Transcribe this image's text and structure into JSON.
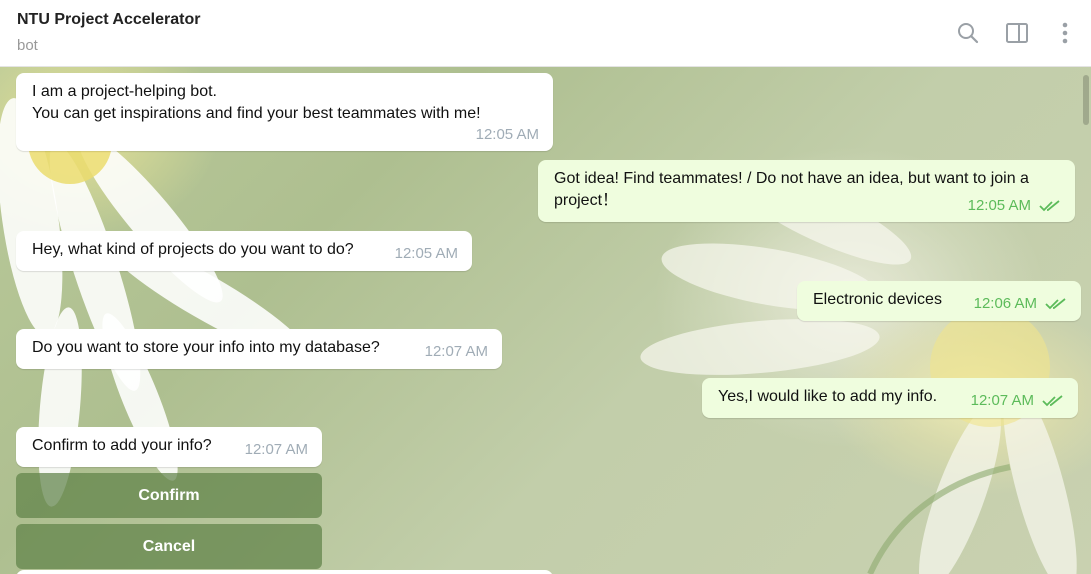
{
  "header": {
    "title": "NTU Project Accelerator",
    "subtitle": "bot"
  },
  "icons": {
    "search": "search-icon",
    "panel": "sidebar-panel-icon",
    "more": "more-vertical-icon",
    "read": "double-check-icon"
  },
  "colors": {
    "incoming_bubble": "#ffffff",
    "outgoing_bubble": "#effdde",
    "outgoing_time": "#5cbb5a",
    "keyboard_button": "#6a8a55"
  },
  "messages": [
    {
      "dir": "in",
      "lines": [
        "I am a project-helping bot.",
        "You can get inspirations and find your best teammates with me!"
      ],
      "time": "12:05 AM"
    },
    {
      "dir": "out",
      "lines": [
        "Got idea! Find teammates! / Do not have an idea, but want to join a",
        "project！"
      ],
      "time": "12:05 AM"
    },
    {
      "dir": "in",
      "lines": [
        "Hey, what kind of projects do you want to do?"
      ],
      "time": "12:05 AM"
    },
    {
      "dir": "out",
      "lines": [
        "Electronic devices"
      ],
      "time": "12:06 AM"
    },
    {
      "dir": "in",
      "lines": [
        "Do you want to store your info into my database?"
      ],
      "time": "12:07 AM"
    },
    {
      "dir": "out",
      "lines": [
        "Yes,I would like to add my info."
      ],
      "time": "12:07 AM"
    },
    {
      "dir": "in",
      "lines": [
        "Confirm to add your info?"
      ],
      "time": "12:07 AM"
    }
  ],
  "keyboard": {
    "confirm": "Confirm",
    "cancel": "Cancel"
  }
}
